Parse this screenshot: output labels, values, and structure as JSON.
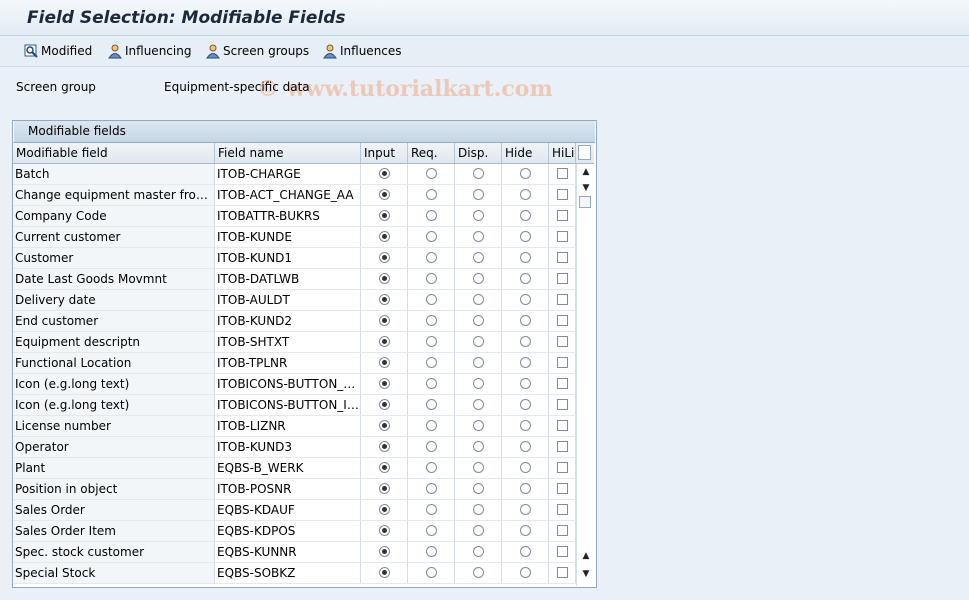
{
  "window": {
    "title": "Field Selection: Modifiable Fields"
  },
  "toolbar": {
    "buttons": [
      {
        "label": "Modified",
        "icon": "modified-icon"
      },
      {
        "label": "Influencing",
        "icon": "influencing-icon"
      },
      {
        "label": "Screen groups",
        "icon": "screen-groups-icon"
      },
      {
        "label": "Influences",
        "icon": "influences-icon"
      }
    ]
  },
  "watermark": "© www.tutorialkart.com",
  "screen_group": {
    "label": "Screen group",
    "value": "Equipment-specific data"
  },
  "table": {
    "caption": "Modifiable fields",
    "columns": [
      "Modifiable field",
      "Field name",
      "Input",
      "Req.",
      "Disp.",
      "Hide",
      "HiLi"
    ],
    "rows": [
      {
        "field": "Batch",
        "name": "ITOB-CHARGE",
        "selected": "Input",
        "hili": false
      },
      {
        "field": "Change equipment master from ass...",
        "name": "ITOB-ACT_CHANGE_AA",
        "selected": "Input",
        "hili": false
      },
      {
        "field": "Company Code",
        "name": "ITOBATTR-BUKRS",
        "selected": "Input",
        "hili": false
      },
      {
        "field": "Current customer",
        "name": "ITOB-KUNDE",
        "selected": "Input",
        "hili": false
      },
      {
        "field": "Customer",
        "name": "ITOB-KUND1",
        "selected": "Input",
        "hili": false
      },
      {
        "field": "Date Last Goods Movmnt",
        "name": "ITOB-DATLWB",
        "selected": "Input",
        "hili": false
      },
      {
        "field": "Delivery date",
        "name": "ITOB-AULDT",
        "selected": "Input",
        "hili": false
      },
      {
        "field": "End customer",
        "name": "ITOB-KUND2",
        "selected": "Input",
        "hili": false
      },
      {
        "field": "Equipment descriptn",
        "name": "ITOB-SHTXT",
        "selected": "Input",
        "hili": false
      },
      {
        "field": "Functional Location",
        "name": "ITOB-TPLNR",
        "selected": "Input",
        "hili": false
      },
      {
        "field": "Icon (e.g.long text)",
        "name": "ITOBICONS-BUTTON_LG...",
        "selected": "Input",
        "hili": false
      },
      {
        "field": "Icon (e.g.long text)",
        "name": "ITOBICONS-BUTTON_IN...",
        "selected": "Input",
        "hili": false
      },
      {
        "field": "License number",
        "name": "ITOB-LIZNR",
        "selected": "Input",
        "hili": false
      },
      {
        "field": "Operator",
        "name": "ITOB-KUND3",
        "selected": "Input",
        "hili": false
      },
      {
        "field": "Plant",
        "name": "EQBS-B_WERK",
        "selected": "Input",
        "hili": false
      },
      {
        "field": "Position in object",
        "name": "ITOB-POSNR",
        "selected": "Input",
        "hili": false
      },
      {
        "field": "Sales Order",
        "name": "EQBS-KDAUF",
        "selected": "Input",
        "hili": false
      },
      {
        "field": "Sales Order Item",
        "name": "EQBS-KDPOS",
        "selected": "Input",
        "hili": false
      },
      {
        "field": "Spec. stock customer",
        "name": "EQBS-KUNNR",
        "selected": "Input",
        "hili": false
      },
      {
        "field": "Special Stock",
        "name": "EQBS-SOBKZ",
        "selected": "Input",
        "hili": false
      }
    ]
  }
}
